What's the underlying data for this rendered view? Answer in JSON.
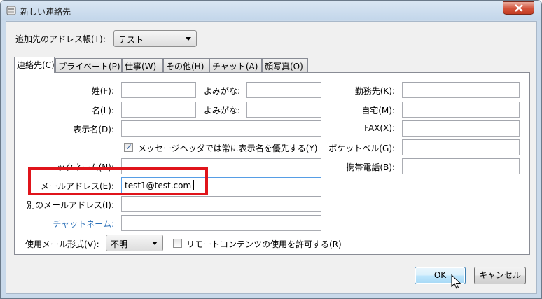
{
  "window": {
    "title": "新しい連絡先",
    "close_icon": "close-icon"
  },
  "addressbook": {
    "label": "追加先のアドレス帳(T):",
    "value": "テスト"
  },
  "tabs": [
    {
      "label": "連絡先(C)",
      "active": true
    },
    {
      "label": "プライベート(P)"
    },
    {
      "label": "仕事(W)"
    },
    {
      "label": "その他(H)"
    },
    {
      "label": "チャット(A)"
    },
    {
      "label": "顔写真(O)"
    }
  ],
  "form": {
    "last_name_label": "姓(F):",
    "last_name_value": "",
    "last_reading_label": "よみがな:",
    "first_name_label": "名(L):",
    "first_name_value": "",
    "first_reading_label": "よみがな:",
    "display_name_label": "表示名(D):",
    "prefer_display_label": "メッセージヘッダでは常に表示名を優先する(Y)",
    "prefer_display_checked": true,
    "nickname_label": "ニックネーム(N):",
    "email_label": "メールアドレス(E):",
    "email_value": "test1@test.com",
    "alt_email_label": "別のメールアドレス(I):",
    "chat_name_label": "チャットネーム:",
    "mail_format_label": "使用メール形式(V):",
    "mail_format_value": "不明",
    "remote_content_label": "リモートコンテンツの使用を許可する(R)",
    "remote_content_checked": false,
    "work_phone_label": "勤務先(K):",
    "home_phone_label": "自宅(M):",
    "fax_label": "FAX(X):",
    "pager_label": "ポケットベル(G):",
    "mobile_label": "携帯電話(B):"
  },
  "buttons": {
    "ok": "OK",
    "cancel": "キャンセル"
  },
  "colors": {
    "highlight_box": "#e0141b",
    "link": "#2a6fb7"
  }
}
